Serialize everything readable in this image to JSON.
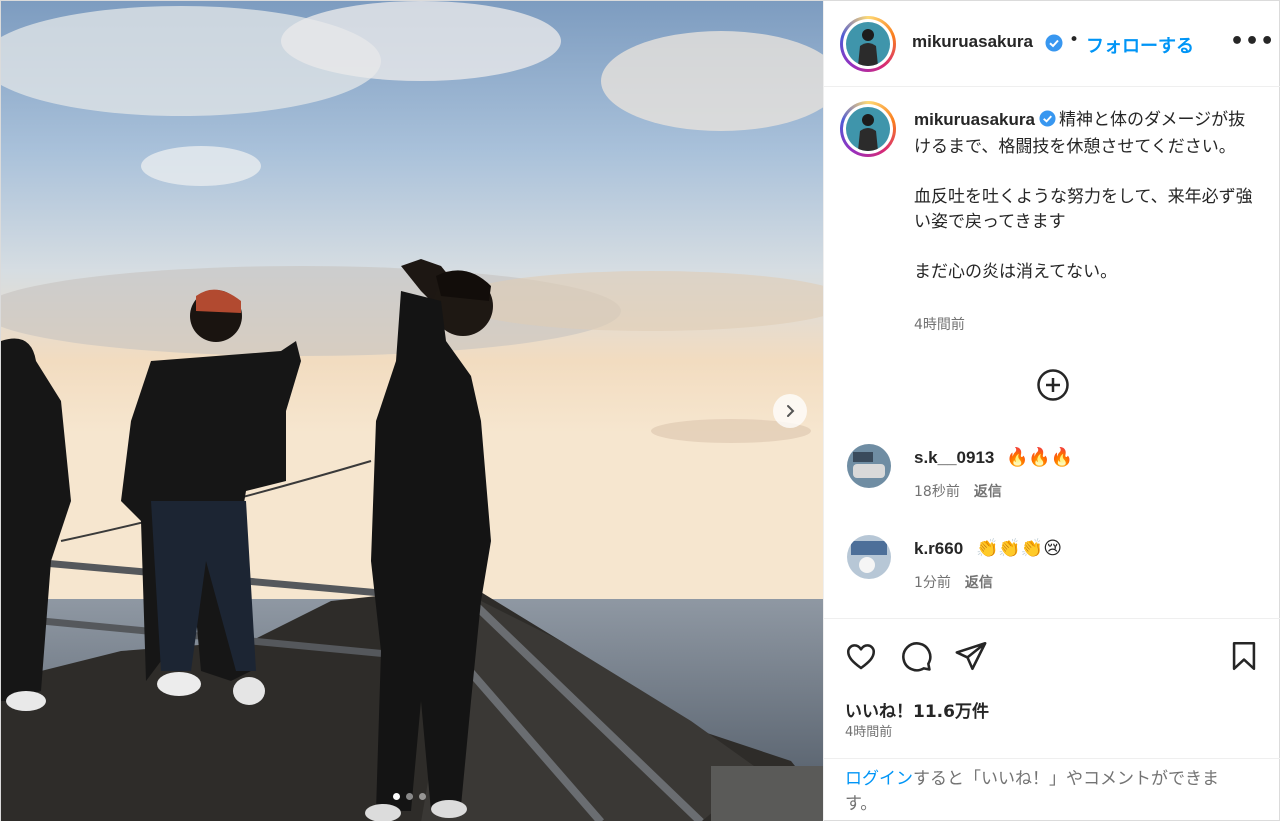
{
  "post": {
    "username": "mikuruasakura",
    "separator": "•",
    "follow_label": "フォローする",
    "more_label": "•••",
    "caption_lines": [
      "精神と体のダメージが抜けるまで、格闘技を休憩させてください。",
      "血反吐を吐くような努力をして、来年必ず強い姿で戻ってきます",
      "まだ心の炎は消えてない。"
    ],
    "caption_time": "4時間前",
    "image_count": 3,
    "active_image_index": 0
  },
  "comments": [
    {
      "username": "s.k__0913",
      "emoji": "🔥🔥🔥",
      "time": "18秒前",
      "reply_label": "返信"
    },
    {
      "username": "k.r660",
      "emoji": "👏👏👏😢",
      "time": "1分前",
      "reply_label": "返信"
    }
  ],
  "stats": {
    "likes": "いいね！11.6万件",
    "time": "4時間前"
  },
  "login": {
    "link": "ログイン",
    "rest": "すると「いいね！」やコメントができます。"
  },
  "colors": {
    "link_blue": "#0095f6",
    "text": "#262626",
    "muted": "#737373",
    "verified": "#3897f0"
  },
  "icons": {
    "verified": "verified-badge-icon",
    "next": "chevron-right-icon",
    "load_more": "plus-circle-icon",
    "like": "heart-icon",
    "comment": "comment-icon",
    "share": "paper-plane-icon",
    "save": "bookmark-icon"
  }
}
